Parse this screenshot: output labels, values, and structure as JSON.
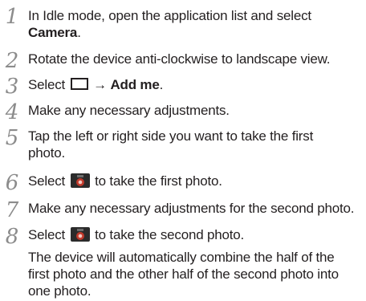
{
  "steps": [
    {
      "num": "1",
      "pre": "In Idle mode, open the application list and select",
      "bold": "Camera",
      "post": "."
    },
    {
      "num": "2",
      "text": "Rotate the device anti-clockwise to landscape view."
    },
    {
      "num": "3",
      "pre": "Select",
      "arrow": "→",
      "bold": "Add me",
      "post": "."
    },
    {
      "num": "4",
      "text": "Make any necessary adjustments."
    },
    {
      "num": "5",
      "line1": "Tap the left or right side you want to take the first",
      "line2": "photo."
    },
    {
      "num": "6",
      "pre": "Select",
      "post": "to take the first photo."
    },
    {
      "num": "7",
      "text": "Make any necessary adjustments for the second photo."
    },
    {
      "num": "8",
      "pre": "Select",
      "post": "to take the second photo."
    }
  ],
  "note": {
    "line1": "The device will automatically combine the half of the",
    "line2": "first photo and the other half of the second photo into",
    "line3": "one photo."
  },
  "icons": {
    "step3": "rectangle-mode-icon",
    "step6": "camera-shutter-icon",
    "step8": "camera-shutter-icon"
  }
}
